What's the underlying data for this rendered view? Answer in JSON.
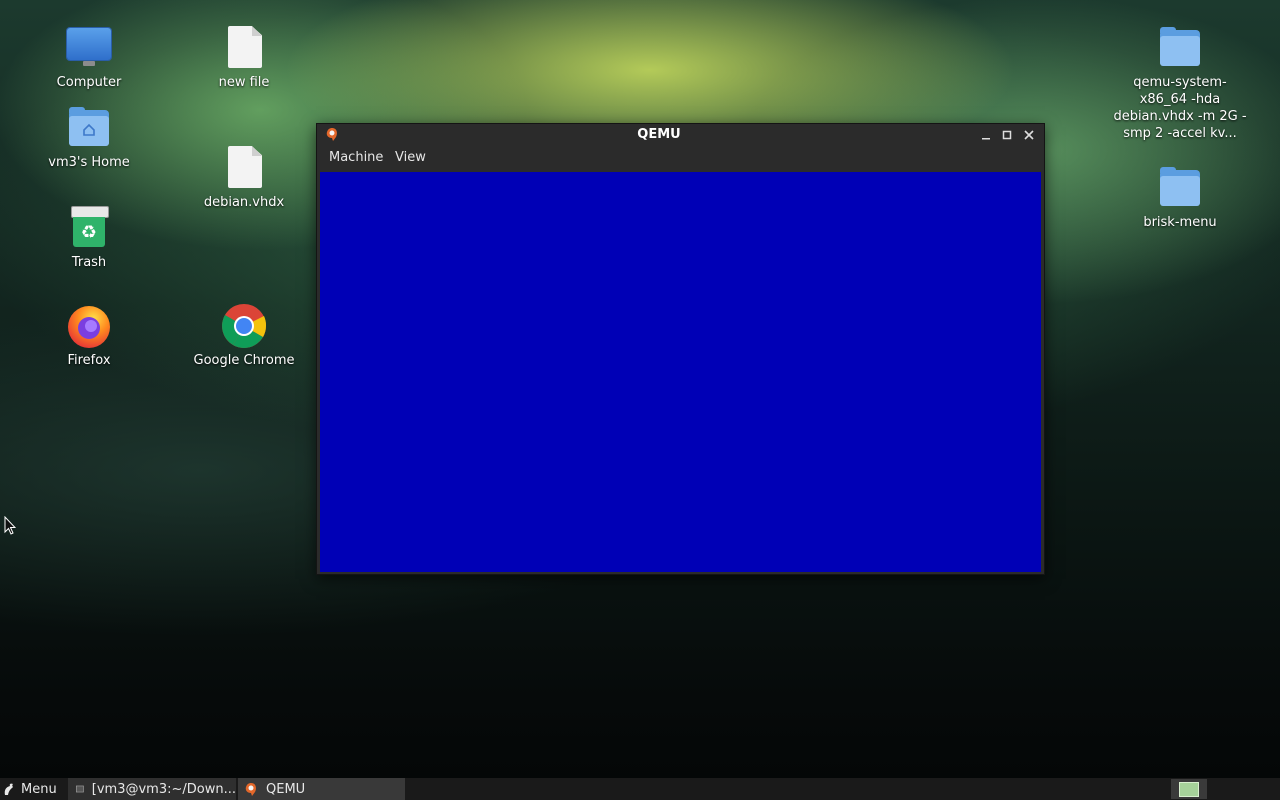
{
  "desktop": {
    "icons": [
      {
        "id": "computer",
        "label": "Computer"
      },
      {
        "id": "new-file",
        "label": "new file"
      },
      {
        "id": "home",
        "label": "vm3's Home"
      },
      {
        "id": "debian",
        "label": "debian.vhdx"
      },
      {
        "id": "trash",
        "label": "Trash"
      },
      {
        "id": "firefox",
        "label": "Firefox"
      },
      {
        "id": "chrome",
        "label": "Google Chrome"
      },
      {
        "id": "qemu-folder",
        "label": "qemu-system-x86_64 -hda debian.vhdx -m 2G -smp 2 -accel kv..."
      },
      {
        "id": "brisk-menu",
        "label": "brisk-menu"
      }
    ]
  },
  "window": {
    "title": "QEMU",
    "menu": [
      "Machine",
      "View"
    ],
    "display_color": "#0000b6"
  },
  "taskbar": {
    "menu_label": "Menu",
    "tasks": [
      {
        "label": "[vm3@vm3:~/Down..."
      },
      {
        "label": "QEMU"
      }
    ]
  },
  "colors": {
    "folder": "#5b9de0",
    "accent_green": "#a6d29a"
  }
}
